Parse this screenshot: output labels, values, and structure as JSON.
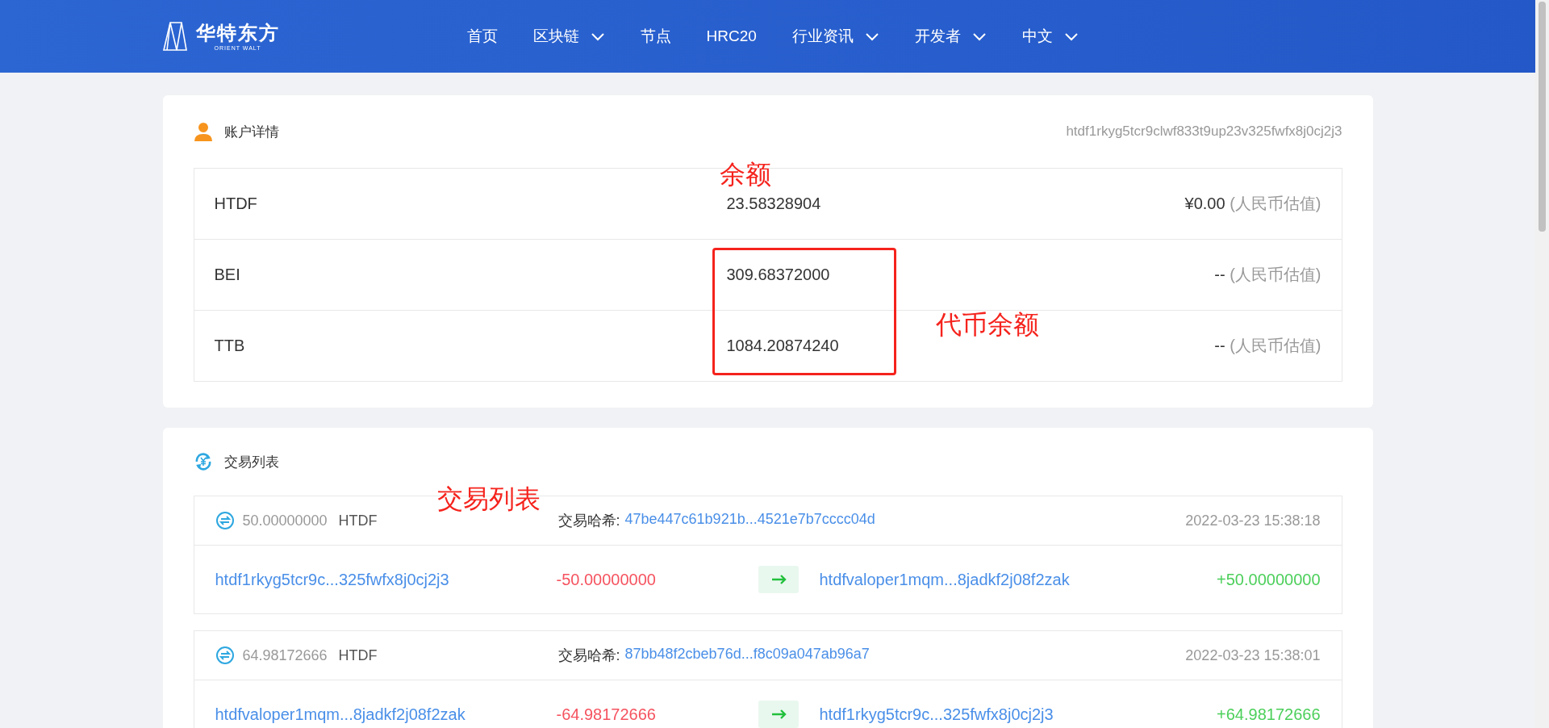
{
  "header": {
    "logo": {
      "name": "华特东方",
      "subtitle": "ORIENT WALT"
    },
    "nav": [
      {
        "label": "首页",
        "dropdown": false
      },
      {
        "label": "区块链",
        "dropdown": true
      },
      {
        "label": "节点",
        "dropdown": false
      },
      {
        "label": "HRC20",
        "dropdown": false
      },
      {
        "label": "行业资讯",
        "dropdown": true
      },
      {
        "label": "开发者",
        "dropdown": true
      },
      {
        "label": "中文",
        "dropdown": true
      }
    ]
  },
  "account": {
    "title": "账户详情",
    "address": "htdf1rkyg5tcr9clwf833t9up23v325fwfx8j0cj2j3",
    "balances": [
      {
        "token": "HTDF",
        "amount": "23.58328904",
        "value": "¥0.00",
        "value_note": "(人民币估值)"
      },
      {
        "token": "BEI",
        "amount": "309.68372000",
        "value": "--",
        "value_note": "(人民币估值)"
      },
      {
        "token": "TTB",
        "amount": "1084.20874240",
        "value": "--",
        "value_note": "(人民币估值)"
      }
    ]
  },
  "transactions": {
    "title": "交易列表",
    "items": [
      {
        "amount": "50.00000000",
        "token": "HTDF",
        "hash_label": "交易哈希:",
        "hash": "47be447c61b921b...4521e7b7cccc04d",
        "time": "2022-03-23 15:38:18",
        "from": "htdf1rkyg5tcr9c...325fwfx8j0cj2j3",
        "from_amount": "-50.00000000",
        "to": "htdfvaloper1mqm...8jadkf2j08f2zak",
        "to_amount": "+50.00000000"
      },
      {
        "amount": "64.98172666",
        "token": "HTDF",
        "hash_label": "交易哈希:",
        "hash": "87bb48f2cbeb76d...f8c09a047ab96a7",
        "time": "2022-03-23 15:38:01",
        "from": "htdfvaloper1mqm...8jadkf2j08f2zak",
        "from_amount": "-64.98172666",
        "to": "htdf1rkyg5tcr9c...325fwfx8j0cj2j3",
        "to_amount": "+64.98172666"
      }
    ]
  },
  "annotations": [
    {
      "kind": "text",
      "text": "余额"
    },
    {
      "kind": "box"
    },
    {
      "kind": "text",
      "text": "代币余额"
    },
    {
      "kind": "text",
      "text": "交易列表"
    }
  ]
}
